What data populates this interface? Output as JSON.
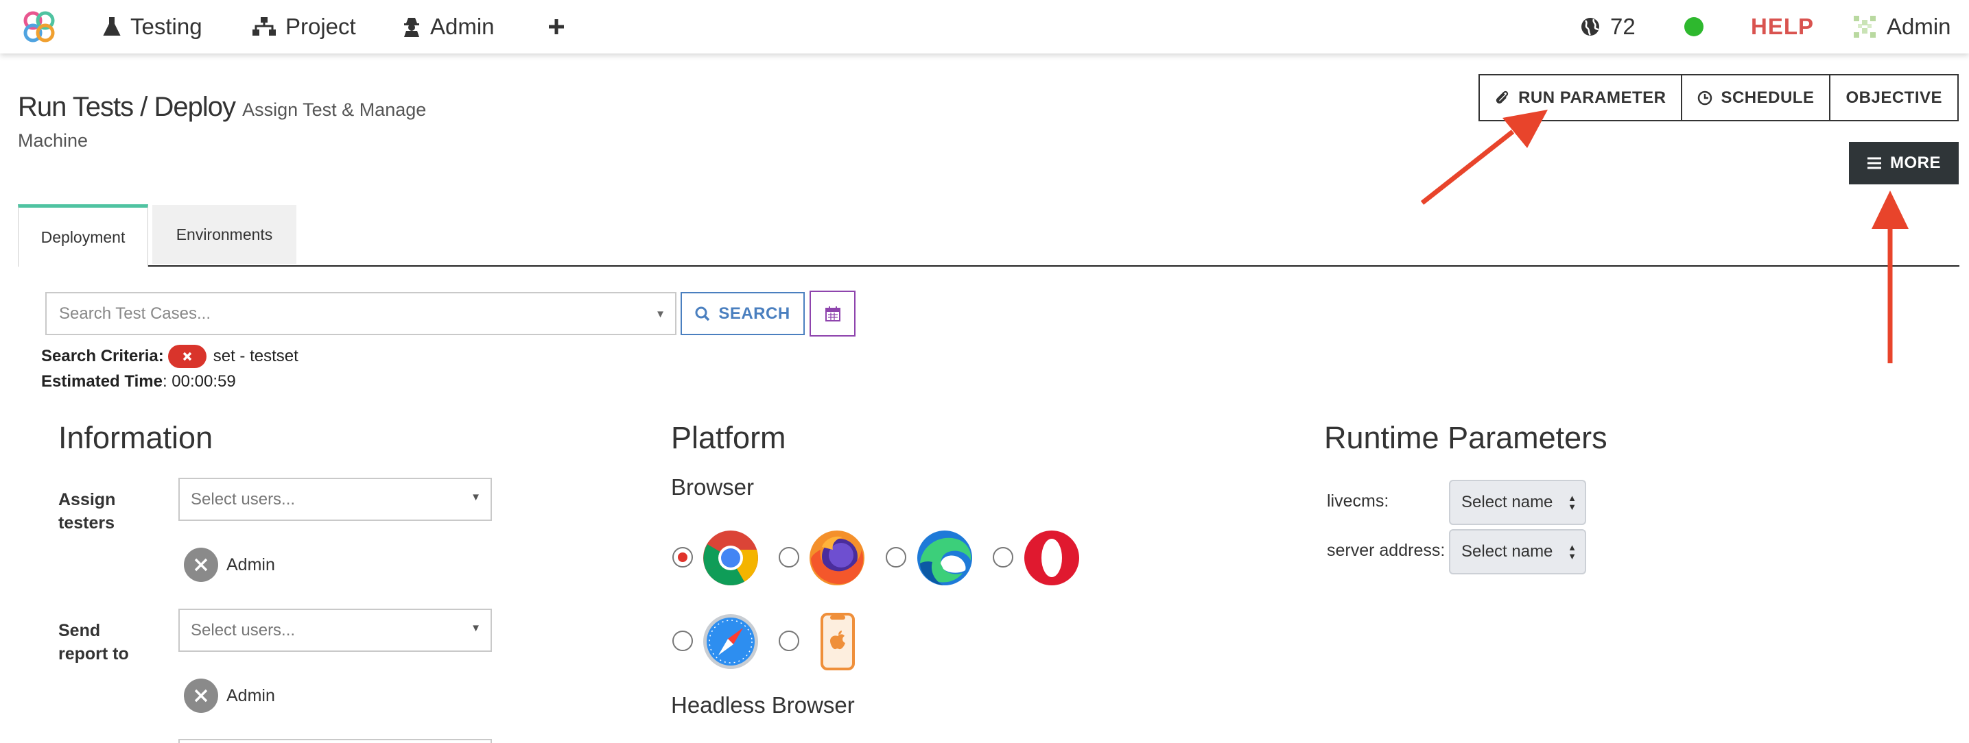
{
  "nav": {
    "items": [
      {
        "label": "Testing",
        "icon": "flask-icon"
      },
      {
        "label": "Project",
        "icon": "sitemap-icon"
      },
      {
        "label": "Admin",
        "icon": "user-secret-icon"
      }
    ],
    "add_icon": "plus-icon",
    "online_count": "72",
    "status_color": "#2eb82e",
    "help_label": "HELP",
    "user_label": "Admin"
  },
  "header": {
    "title": "Run Tests / Deploy",
    "subtitle": "Assign Test & Manage",
    "subtitle_line2": "Machine",
    "run_parameter_label": "RUN PARAMETER",
    "schedule_label": "SCHEDULE",
    "objective_label": "OBJECTIVE",
    "more_label": "MORE"
  },
  "tabs": [
    {
      "label": "Deployment",
      "active": true
    },
    {
      "label": "Environments",
      "active": false
    }
  ],
  "search": {
    "placeholder": "Search Test Cases...",
    "button_label": "SEARCH",
    "criteria_label": "Search Criteria:",
    "criteria_value": "set - testset",
    "estimated_label": "Estimated Time",
    "estimated_value": ": 00:00:59"
  },
  "information": {
    "title": "Information",
    "assign_label_1": "Assign",
    "assign_label_2": "testers",
    "assign_placeholder": "Select users...",
    "assign_chip": "Admin",
    "report_label_1": "Send",
    "report_label_2": "report to",
    "report_placeholder": "Select users...",
    "report_chip": "Admin"
  },
  "platform": {
    "title": "Platform",
    "browser_label": "Browser",
    "browsers": [
      {
        "icon": "chrome-icon",
        "selected": true
      },
      {
        "icon": "firefox-icon",
        "selected": false
      },
      {
        "icon": "edge-icon",
        "selected": false
      },
      {
        "icon": "opera-icon",
        "selected": false
      },
      {
        "icon": "safari-icon",
        "selected": false
      },
      {
        "icon": "ios-device-icon",
        "selected": false
      }
    ],
    "headless_label": "Headless Browser"
  },
  "runtime": {
    "title": "Runtime Parameters",
    "params": [
      {
        "label": "livecms:",
        "value": "Select name"
      },
      {
        "label": "server address:",
        "value": "Select name"
      }
    ]
  },
  "annotation_color": "#e8442b"
}
